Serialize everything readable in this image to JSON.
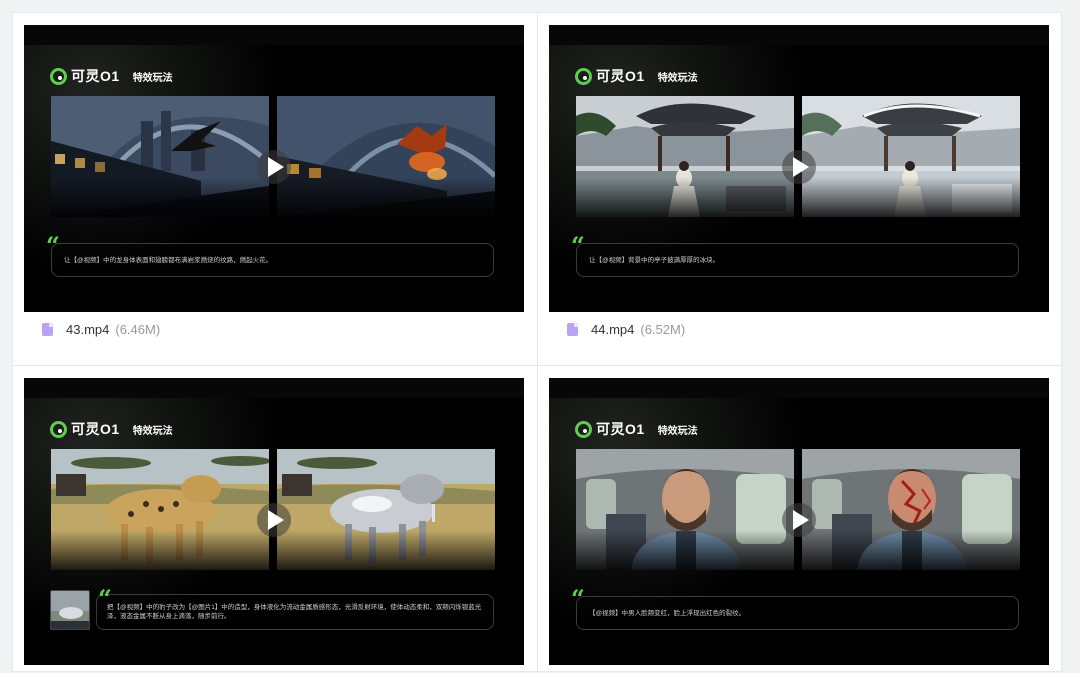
{
  "cards": [
    {
      "brand": "可灵O1",
      "feature": "特效玩法",
      "prompt": "让【@视频】中的龙身体表面和翅膀都布满岩浆燃烧的纹路，燃起火花。",
      "file_name": "43.mp4",
      "file_size": "(6.46M)"
    },
    {
      "brand": "可灵O1",
      "feature": "特效玩法",
      "prompt": "让【@视频】背景中的亭子披满厚厚的冰块。",
      "file_name": "44.mp4",
      "file_size": "(6.52M)"
    },
    {
      "brand": "可灵O1",
      "feature": "特效玩法",
      "prompt": "把【@视频】中的豹子改为【@图片1】中的造型，身体液化为流动金属质感形态，光滑反射环境，使体动态柔和，双颊闪烁银蓝光泽，液态金属不断从身上滴落，随步前行。"
    },
    {
      "brand": "可灵O1",
      "feature": "特效玩法",
      "prompt": "【@视频】中男人脸颊变红，脸上浮现出红色的裂纹。"
    }
  ],
  "colors": {
    "accent": "#5fce4e",
    "frame_bg": "#000000",
    "file_icon": "#b9a3f5"
  },
  "icons": {
    "play": "play-icon",
    "file": "video-file-icon",
    "quote": "quote-icon",
    "logo": "kling-logo-icon"
  }
}
